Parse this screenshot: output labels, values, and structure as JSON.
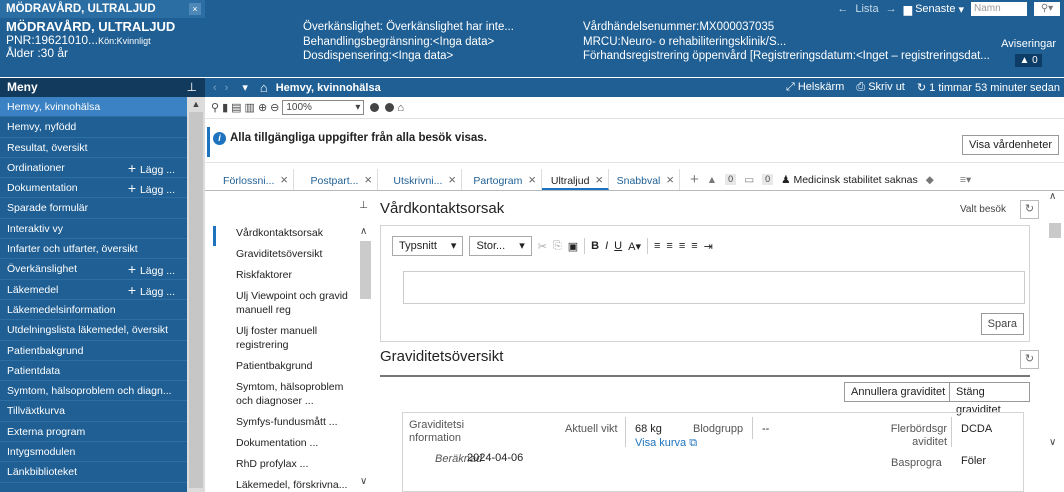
{
  "header": {
    "tab_label": "MÖDRAVÅRD, ULTRALJUD",
    "tab_close": "×",
    "patient_name": "MÖDRAVÅRD, ULTRALJUD",
    "pnr": "PNR:19621010...",
    "sex": "Kön:Kvinnligt",
    "age": "Ålder :30 år",
    "info_col1": [
      "Överkänslighet: Överkänslighet har inte...",
      "Behandlingsbegränsning:<Inga data>",
      "Dosdispensering:<Inga data>"
    ],
    "info_col2": [
      "Vårdhändelsenummer:MX000037035",
      "MRCU:Neuro- o rehabiliteringsklinik/S...",
      "Förhandsregistrering öppenvård [Registreringsdatum:<Inget – registreringsdat..."
    ],
    "list_label": "Lista",
    "recent_label": "Senaste",
    "name_placeholder": "Namn",
    "notifications_label": "Aviseringar",
    "notifications_count": "0"
  },
  "menu": {
    "title": "Meny",
    "items": [
      {
        "label": "Hemvy, kvinnohälsa",
        "add": ""
      },
      {
        "label": "Hemvy, nyfödd",
        "add": ""
      },
      {
        "label": "Resultat, översikt",
        "add": ""
      },
      {
        "label": "Ordinationer",
        "add": "Lägg ..."
      },
      {
        "label": "Dokumentation",
        "add": "Lägg ..."
      },
      {
        "label": "Sparade formulär",
        "add": ""
      },
      {
        "label": "Interaktiv vy",
        "add": ""
      },
      {
        "label": "Infarter och utfarter, översikt",
        "add": ""
      },
      {
        "label": "Överkänslighet",
        "add": "Lägg ..."
      },
      {
        "label": "Läkemedel",
        "add": "Lägg ..."
      },
      {
        "label": "Läkemedelsinformation",
        "add": ""
      },
      {
        "label": "Utdelningslista läkemedel, översikt",
        "add": ""
      },
      {
        "label": "Patientbakgrund",
        "add": ""
      },
      {
        "label": "Patientdata",
        "add": ""
      },
      {
        "label": "Symtom, hälsoproblem och diagn...",
        "add": ""
      },
      {
        "label": "Tillväxtkurva",
        "add": ""
      },
      {
        "label": "Externa program",
        "add": ""
      },
      {
        "label": "Intygsmodulen",
        "add": ""
      },
      {
        "label": "Länkbiblioteket",
        "add": ""
      }
    ]
  },
  "navbar": {
    "title": "Hemvy, kvinnohälsa",
    "fullscreen": "Helskärm",
    "print": "Skriv ut",
    "refresh_time": "1 timmar 53 minuter sedan"
  },
  "toolbar": {
    "zoom": "100%"
  },
  "info": {
    "message": "Alla tillgängliga uppgifter från alla besök visas.",
    "show_units": "Visa vårdenheter"
  },
  "tabs": {
    "items": [
      {
        "label": "Förlossni...",
        "closable": true
      },
      {
        "label": "Postpart...",
        "closable": true
      },
      {
        "label": "Utskrivni...",
        "closable": true
      },
      {
        "label": "Partogram",
        "closable": true
      },
      {
        "label": "Ultraljud",
        "closable": true
      },
      {
        "label": "Snabbval",
        "closable": true
      }
    ],
    "count1": "0",
    "count2": "0",
    "stability": "Medicinsk stabilitet saknas"
  },
  "toc": {
    "items": [
      "Vårdkontaktsorsak",
      "Graviditetsöversikt",
      "Riskfaktorer",
      "Ulj Viewpoint och gravid manuell reg",
      "Ulj foster manuell registrering",
      "Patientbakgrund",
      "Symtom, hälsoproblem och diagnoser ...",
      "Symfys-fundusmått ...",
      "Dokumentation ...",
      "RhD profylax ...",
      "Läkemedel, förskrivna..."
    ]
  },
  "section1": {
    "title": "Vårdkontaktsorsak",
    "select_visit": "Valt besök",
    "font_label": "Typsnitt",
    "size_label": "Stor...",
    "save": "Spara"
  },
  "section2": {
    "title": "Graviditetsöversikt",
    "cancel_pregnancy": "Annullera graviditet",
    "close_pregnancy": "Stäng graviditet",
    "info_label": "Graviditetsi nformation",
    "calculated_label": "Beräknad",
    "calculated_date": "2024-04-06",
    "weight_label": "Aktuell vikt",
    "weight_value": "68 kg",
    "curve_link": "Visa kurva",
    "bloodgroup_label": "Blodgrupp",
    "bloodgroup_value": "--",
    "multiple_label": "Flerbördsgr aviditet",
    "multiple_value": "DCDA",
    "basis_label": "Basprogra",
    "fetus_label": "Föler"
  }
}
